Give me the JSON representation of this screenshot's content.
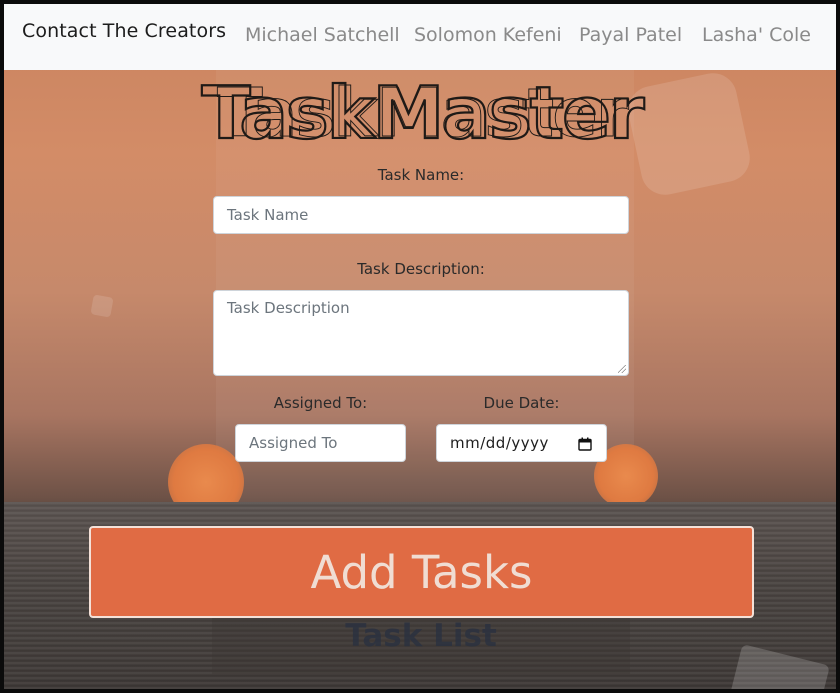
{
  "navbar": {
    "brand": "Contact The Creators",
    "links": [
      "Michael Satchell",
      "Solomon Kefeni",
      "Payal Patel",
      "Lasha' Cole"
    ]
  },
  "app_title": "TaskMaster",
  "form": {
    "task_name_label": "Task Name:",
    "task_name_placeholder": "Task Name",
    "task_description_label": "Task Description:",
    "task_description_placeholder": "Task Description",
    "assigned_to_label": "Assigned To:",
    "assigned_to_placeholder": "Assigned To",
    "due_date_label": "Due Date:",
    "due_date_value": "mm/dd/yyyy",
    "submit_label": "Add Tasks"
  },
  "task_list": {
    "title": "Task List"
  },
  "colors": {
    "button": "#e06b44",
    "navbar": "#f8f9fa"
  }
}
